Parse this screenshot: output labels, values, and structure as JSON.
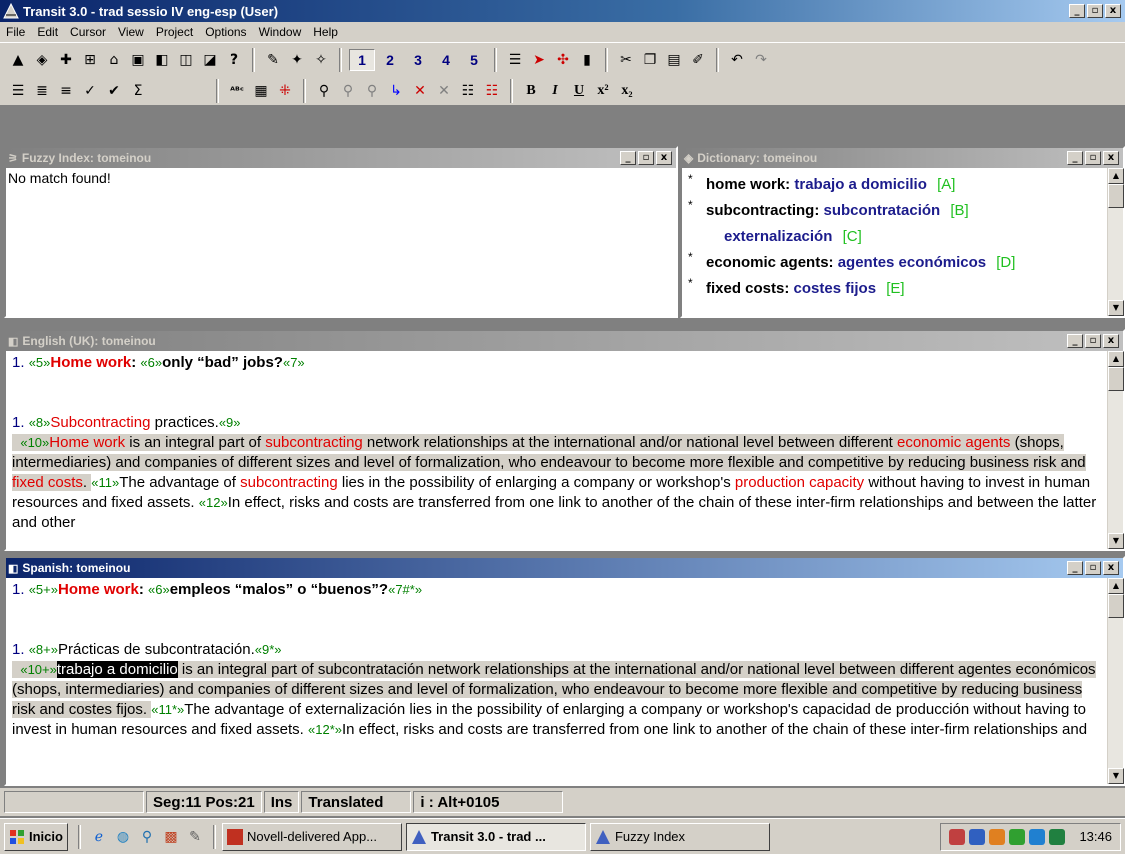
{
  "window": {
    "title": "Transit 3.0 - trad sessio IV eng-esp (User)",
    "controls": [
      "_",
      "▫",
      "x"
    ]
  },
  "menu": [
    "File",
    "Edit",
    "Cursor",
    "View",
    "Project",
    "Options",
    "Window",
    "Help"
  ],
  "toolbar": {
    "numbers": [
      "1",
      "2",
      "3",
      "4",
      "5"
    ],
    "format": [
      "B",
      "I",
      "U",
      "x²",
      "x₂"
    ]
  },
  "panels": {
    "fuzzy": {
      "title": "Fuzzy Index: tomeinou",
      "message": "No match found!"
    },
    "dictionary": {
      "title": "Dictionary: tomeinou",
      "entries": [
        {
          "source": "home work:",
          "target": "trabajo a domicilio",
          "tag": "[A]"
        },
        {
          "source": "subcontracting:",
          "target": "subcontratación",
          "tag": "[B]"
        },
        {
          "source": "",
          "target": "externalización",
          "tag": "[C]"
        },
        {
          "source": "economic agents:",
          "target": "agentes económicos",
          "tag": "[D]"
        },
        {
          "source": "fixed costs:",
          "target": "costes fijos",
          "tag": "[E]"
        }
      ]
    },
    "english": {
      "title": "English (UK): tomeinou",
      "line1": {
        "num": "1.",
        "t5": "«5»",
        "hw": "Home work",
        "colon": ":",
        "t6": "«6»",
        "rest": "only “bad” jobs?",
        "t7": "«7»"
      },
      "line2": {
        "num": "1.",
        "t8": "«8»",
        "sub": "Subcontracting",
        "rest": " practices.",
        "t9": "«9»"
      },
      "para": {
        "t10": "«10»",
        "hw": "Home work",
        "a": " is an integral part of ",
        "sub1": "subcontracting",
        "b": " network relationships at the international and/or national level between different ",
        "ea": "economic agents",
        "c": " (shops, intermediaries) and companies of different sizes and level of formalization, who endeavour to become more flexible and competitive by reducing business risk and ",
        "fc": "fixed costs",
        "d": ". ",
        "t11": "«11»",
        "e": "The advantage of ",
        "sub2": "subcontracting",
        "f": " lies in the possibility of enlarging a company or workshop's ",
        "pc": "production capacity",
        "g": " without having to invest in human resources and fixed assets. ",
        "t12": "«12»",
        "h": "In effect, risks and costs are transferred from one link to another of the chain of these inter-firm relationships and between the latter and other"
      }
    },
    "spanish": {
      "title": "Spanish: tomeinou",
      "line1": {
        "num": "1.",
        "t5": "«5+»",
        "hw": "Home work",
        "colon": ":",
        "t6": "«6»",
        "rest": "empleos “malos” o “buenos”?",
        "t7": "«7#*»"
      },
      "line2": {
        "num": "1.",
        "t8": "«8+»",
        "rest": "Prácticas de subcontratación.",
        "t9": "«9*»"
      },
      "para": {
        "t10": "«10+»",
        "sel": "trabajo a domicilio",
        "a": " is an integral part of subcontratación network relationships at the international and/or national level between different agentes económicos (shops, intermediaries) and companies of different sizes and level of formalization, who endeavour to become more flexible and competitive by reducing business risk and costes fijos. ",
        "t11": "«11*»",
        "b": "The advantage of externalización lies in the possibility of enlarging a company or workshop's capacidad de producción without having to invest in human resources and fixed assets. ",
        "t12": "«12*»",
        "c": "In effect, risks and costs are transferred from one link to another of the chain of these inter-firm relationships and"
      }
    }
  },
  "status": {
    "segpos": "Seg:11 Pos:21",
    "mode": "Ins",
    "state": "Translated",
    "char": "i : Alt+0105"
  },
  "taskbar": {
    "start": "Inicio",
    "tasks": [
      "Novell-delivered App...",
      "Transit 3.0 - trad ...",
      "Fuzzy Index"
    ],
    "clock": "13:46"
  },
  "colors": {
    "title_active": "#0a246a",
    "term_red": "#e00000",
    "tag_green": "#008000",
    "dict_target": "#1c1c8c",
    "dict_tag": "#20c020"
  }
}
